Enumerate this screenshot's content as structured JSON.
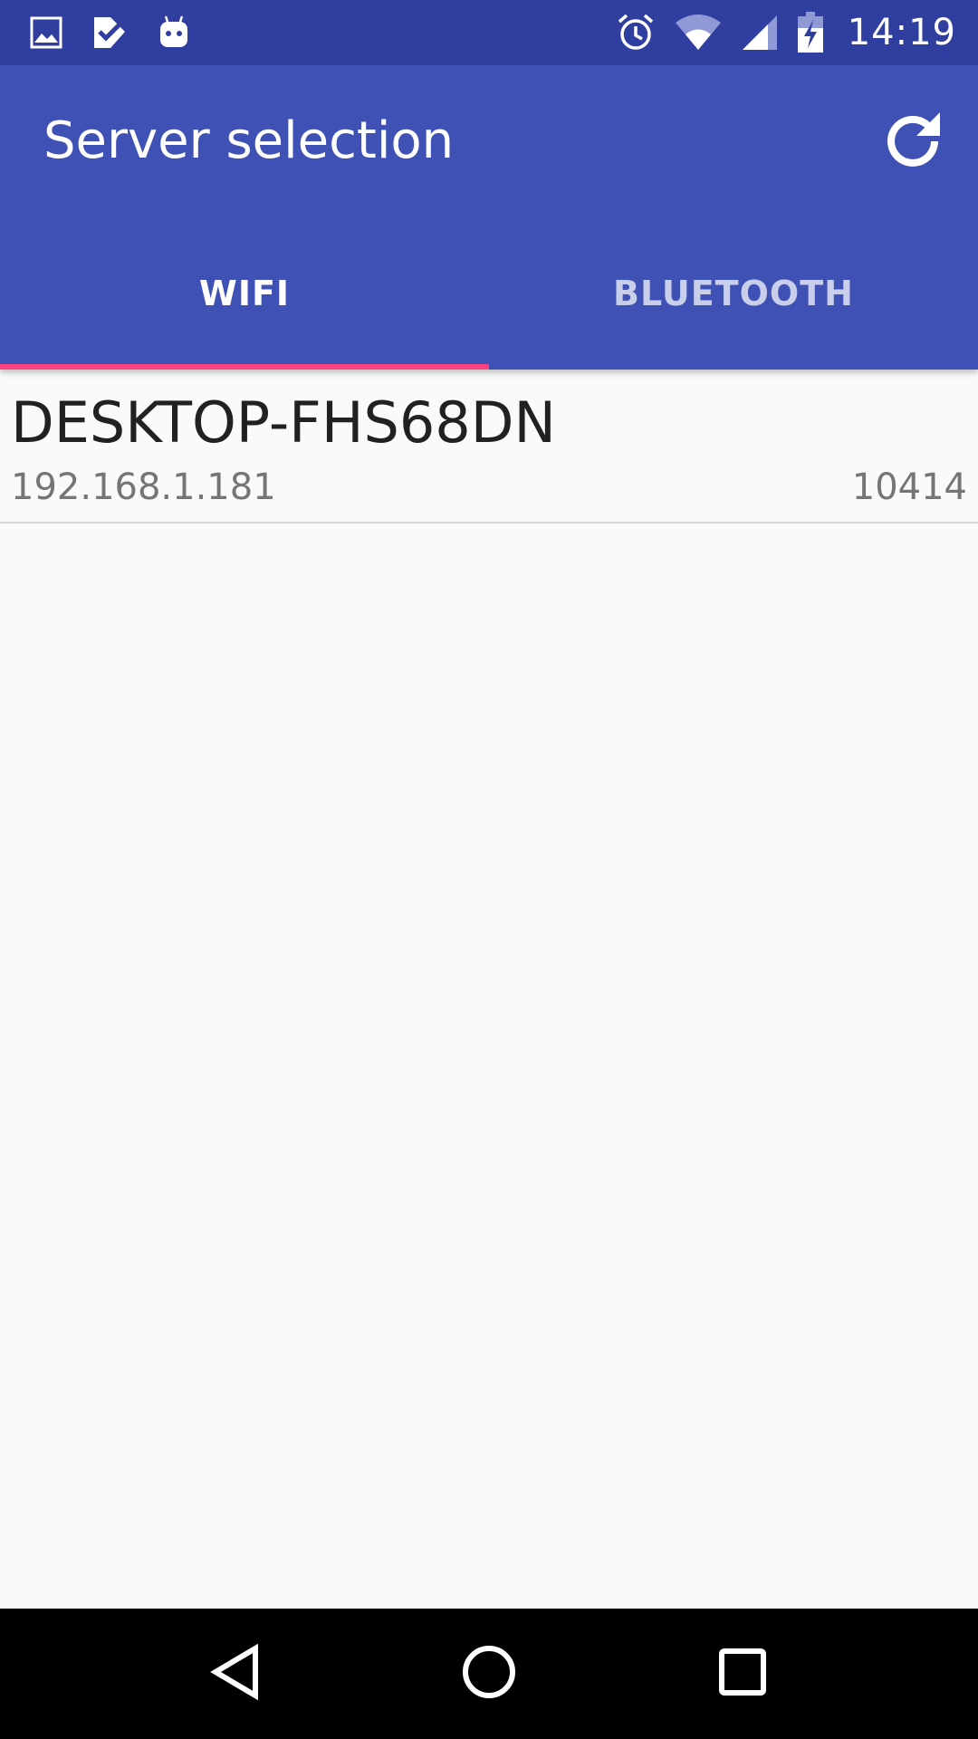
{
  "status_bar": {
    "time": "14:19",
    "left_icons": [
      "image-icon",
      "check-badge-icon",
      "android-icon"
    ],
    "right_icons": [
      "alarm-icon",
      "wifi-icon",
      "cell-signal-icon",
      "battery-charging-icon"
    ]
  },
  "app_bar": {
    "title": "Server selection",
    "action_icon": "refresh-icon"
  },
  "tabs": [
    {
      "label": "WIFI",
      "selected": true
    },
    {
      "label": "BLUETOOTH",
      "selected": false
    }
  ],
  "servers": [
    {
      "name": "DESKTOP-FHS68DN",
      "ip": "192.168.1.181",
      "port": "10414"
    }
  ],
  "nav_bar": {
    "buttons": [
      "back-icon",
      "home-icon",
      "recents-icon"
    ]
  },
  "colors": {
    "status_bar": "#303F9F",
    "primary": "#3F51B5",
    "accent": "#FF4081",
    "background": "#FAFAFA",
    "nav_bar": "#000000"
  }
}
